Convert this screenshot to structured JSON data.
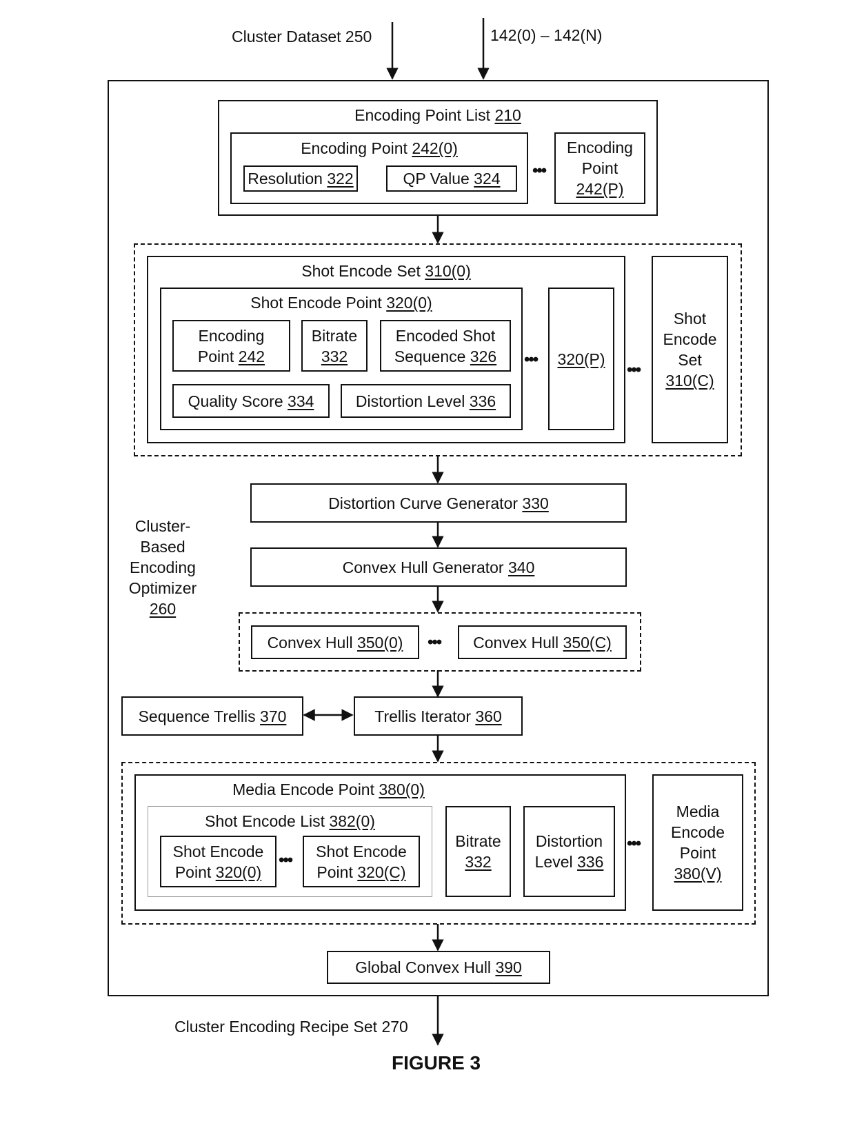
{
  "inputs": {
    "cluster_dataset": "Cluster Dataset 250",
    "sequences": "142(0) – 142(N)"
  },
  "optimizer": {
    "line1": "Cluster-",
    "line2": "Based",
    "line3": "Encoding",
    "line4": "Optimizer",
    "ref": "260"
  },
  "encoding_point_list": {
    "title": "Encoding Point List ",
    "ref": "210",
    "point0": {
      "title": "Encoding Point ",
      "ref": "242(0)",
      "resolution": "Resolution ",
      "resolution_ref": "322",
      "qp": "QP Value ",
      "qp_ref": "324"
    },
    "pointP": {
      "line1": "Encoding",
      "line2": "Point",
      "ref": "242(P)"
    }
  },
  "shot_encode_sets": {
    "set0": {
      "title": "Shot Encode Set ",
      "ref": "310(0)",
      "point0": {
        "title": "Shot Encode Point ",
        "ref": "320(0)",
        "encoding_point": "Encoding",
        "encoding_point2": "Point ",
        "encoding_point_ref": "242",
        "bitrate": "Bitrate",
        "bitrate_ref": "332",
        "encoded_shot": "Encoded Shot",
        "encoded_shot2": "Sequence ",
        "encoded_shot_ref": "326",
        "quality": "Quality Score ",
        "quality_ref": "334",
        "distortion": "Distortion Level ",
        "distortion_ref": "336"
      },
      "pointP_ref": "320(P)"
    },
    "setC": {
      "line1": "Shot",
      "line2": "Encode",
      "line3": "Set",
      "ref": "310(C)"
    }
  },
  "distortion_curve_generator": {
    "label": "Distortion Curve Generator ",
    "ref": "330"
  },
  "convex_hull_generator": {
    "label": "Convex Hull Generator ",
    "ref": "340"
  },
  "convex_hulls": {
    "hull0": {
      "label": "Convex Hull ",
      "ref": "350(0)"
    },
    "hullC": {
      "label": "Convex Hull ",
      "ref": "350(C)"
    }
  },
  "sequence_trellis": {
    "label": "Sequence Trellis ",
    "ref": "370"
  },
  "trellis_iterator": {
    "label": "Trellis Iterator ",
    "ref": "360"
  },
  "media_encode_points": {
    "point0": {
      "title": "Media Encode Point ",
      "ref": "380(0)",
      "shot_list": {
        "title": "Shot Encode List ",
        "ref": "382(0)",
        "item0": {
          "line1": "Shot Encode",
          "line2": "Point ",
          "ref": "320(0)"
        },
        "itemC": {
          "line1": "Shot Encode",
          "line2": "Point ",
          "ref": "320(C)"
        }
      },
      "bitrate": "Bitrate",
      "bitrate_ref": "332",
      "distortion1": "Distortion",
      "distortion2": "Level ",
      "distortion_ref": "336"
    },
    "pointV": {
      "line1": "Media",
      "line2": "Encode",
      "line3": "Point",
      "ref": "380(V)"
    }
  },
  "global_convex_hull": {
    "label": "Global Convex Hull ",
    "ref": "390"
  },
  "output": {
    "label": "Cluster Encoding Recipe Set 270"
  },
  "figure_label": "FIGURE 3"
}
